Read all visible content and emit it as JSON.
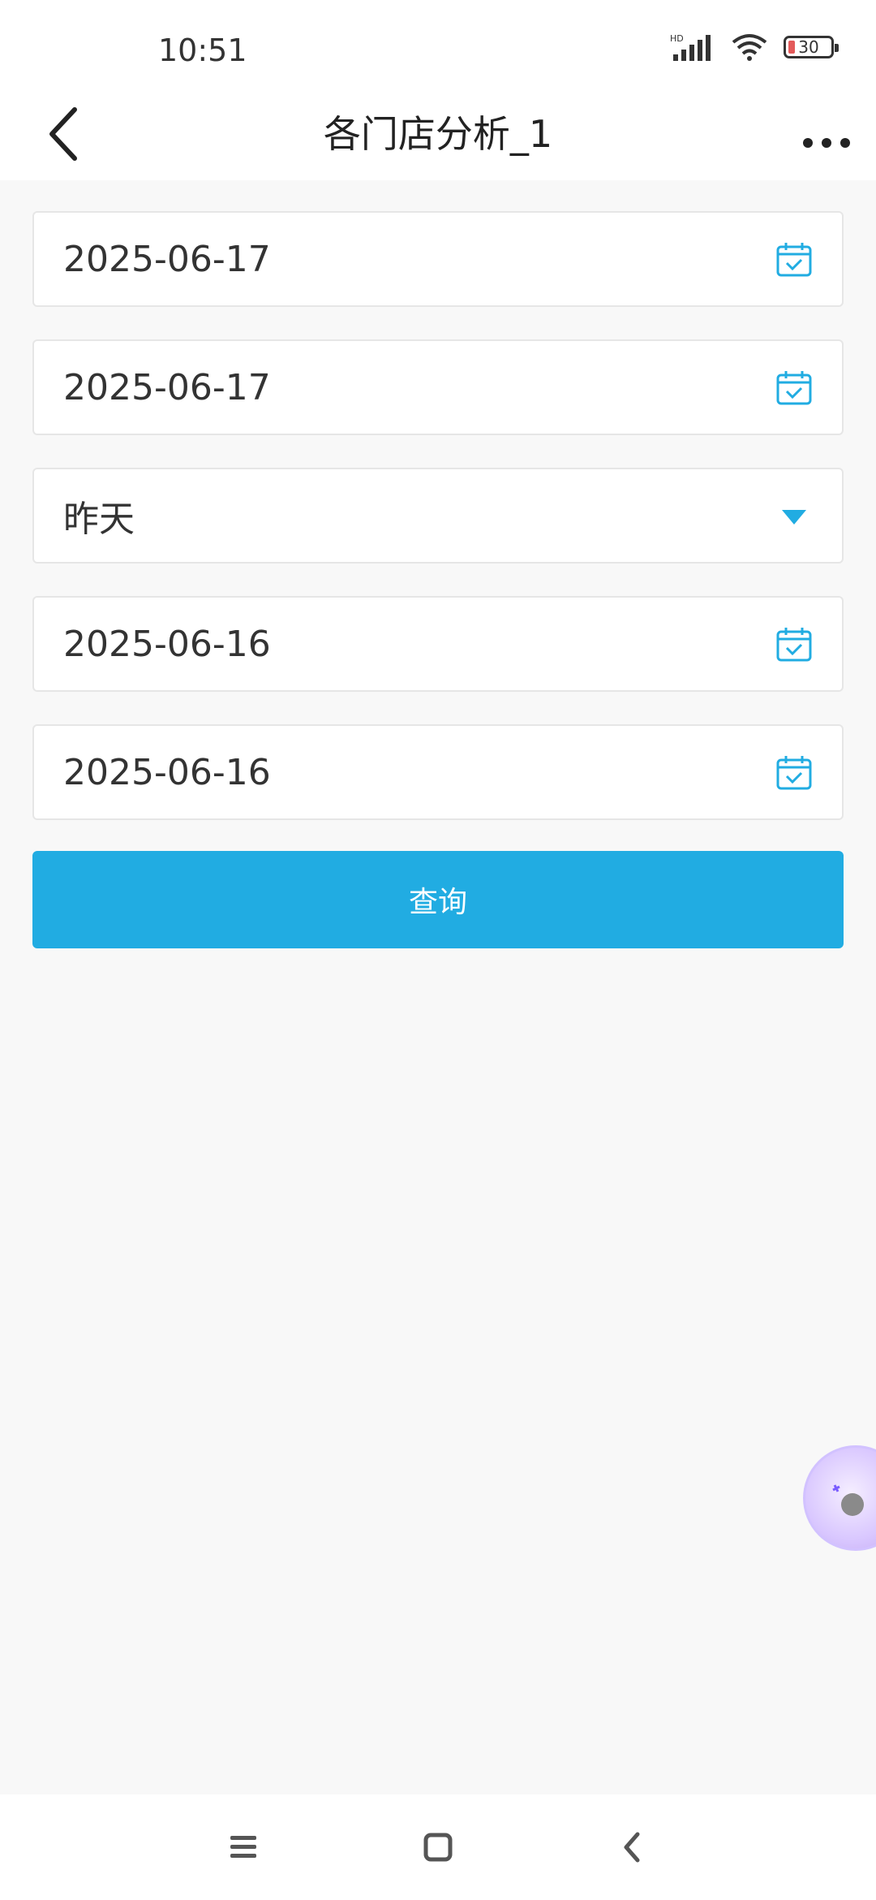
{
  "status_bar": {
    "time": "10:51",
    "network": "HD",
    "battery": "30"
  },
  "header": {
    "title": "各门店分析_1"
  },
  "form": {
    "fields": [
      {
        "value": "2025-06-17",
        "type": "date",
        "icon": "calendar-icon"
      },
      {
        "value": "2025-06-17",
        "type": "date",
        "icon": "calendar-icon"
      },
      {
        "value": "昨天",
        "type": "select",
        "icon": "dropdown-triangle-icon"
      },
      {
        "value": "2025-06-16",
        "type": "date",
        "icon": "calendar-icon"
      },
      {
        "value": "2025-06-16",
        "type": "date",
        "icon": "calendar-icon"
      }
    ],
    "query_label": "查询"
  },
  "colors": {
    "accent": "#21ace2",
    "background": "#f8f8f8",
    "field_border": "#e6e6e6"
  }
}
